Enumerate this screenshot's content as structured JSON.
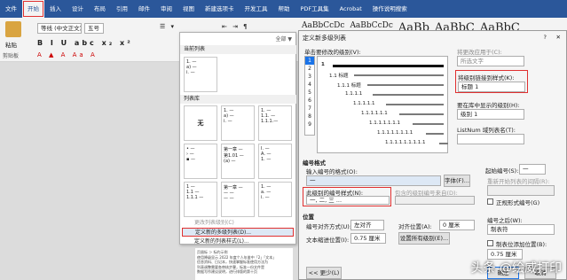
{
  "ribbon": {
    "tabs": [
      "文件",
      "开始",
      "插入",
      "设计",
      "布局",
      "引用",
      "邮件",
      "审阅",
      "视图",
      "新建选项卡",
      "开发工具",
      "帮助",
      "PDF工具集",
      "Acrobat",
      "操作说明搜索"
    ],
    "clipboard_label": "粘贴",
    "clipboard_group": "剪贴板",
    "font_name": "等线 (中文正文)",
    "font_size": "五号",
    "styles_sample": [
      "AaBbCcDc",
      "AaBbCcDc",
      "AaBb",
      "AaBbC",
      "AaBbC"
    ]
  },
  "list_menu": {
    "all_label": "全部 ▼",
    "current_list_header": "当前列表",
    "library_header": "列表库",
    "none_label": "无",
    "document_lists_header": "文档中的列表",
    "change_level": "更改列表级别(C)",
    "define_new": "定义新的多级列表(D)...",
    "define_style": "定义新的列表样式(L)..."
  },
  "document_text": [
    "页眉标 ＞ 标约示例",
    "使用降级显示 2022 年度个人年鉴中「2」「文本」",
    "信息资料、日记本，快速掌握标准使用方法为",
    "列表调整需要各审核步骤，标准一份文件是",
    "数据写作建议说明，进行排版的第十页"
  ],
  "dialog": {
    "title": "定义新多级列表",
    "help": "?",
    "close": "✕",
    "click_level_label": "单击要修改的级别(V):",
    "levels": [
      "1",
      "2",
      "3",
      "4",
      "5",
      "6",
      "7",
      "8",
      "9"
    ],
    "preview_labels": [
      "1",
      "1.1 标题",
      "1.1.1 标题",
      "1.1.1.1",
      "1.1.1.1.1",
      "1.1.1.1.1.1",
      "1.1.1.1.1.1.1",
      "1.1.1.1.1.1.1.1",
      "1.1.1.1.1.1.1.1.1"
    ],
    "apply_to_label": "将更改应用于(C):",
    "apply_to_value": "所选文字",
    "link_style_label": "将级别链接到样式(K):",
    "link_style_value": "标题 1",
    "gallery_level_label": "要在库中显示的级别(H):",
    "gallery_level_value": "级别 1",
    "listnum_label": "ListNum 域列表名(T):",
    "number_format_header": "编号格式",
    "enter_format_label": "输入编号的格式(O):",
    "enter_format_value": "一",
    "font_button": "字体(F)...",
    "start_at_label": "起始编号(S):",
    "start_at_value": "一",
    "restart_label": "重新开始列表的间隔(R):",
    "number_style_label": "此级别的编号样式(N):",
    "number_style_value": "一, 二, 三 ...",
    "include_level_label": "包含的级别编号来自(D):",
    "legal_label": "正规形式编号(G)",
    "position_header": "位置",
    "alignment_label": "编号对齐方式(U):",
    "alignment_value": "左对齐",
    "aligned_at_label": "对齐位置(A):",
    "aligned_at_value": "0 厘米",
    "indent_label": "文本缩进位置(I):",
    "indent_value": "0.75 厘米",
    "set_all_button": "设置所有级别(E)...",
    "follow_label": "编号之后(W):",
    "follow_value": "制表符",
    "tab_add_label": "制表位添加位置(B):",
    "tab_add_value": "0.75 厘米",
    "less_button": "<< 更少(L)",
    "ok_button": "确定",
    "cancel_button": "取消"
  },
  "watermark": "头条 @绘威打印"
}
